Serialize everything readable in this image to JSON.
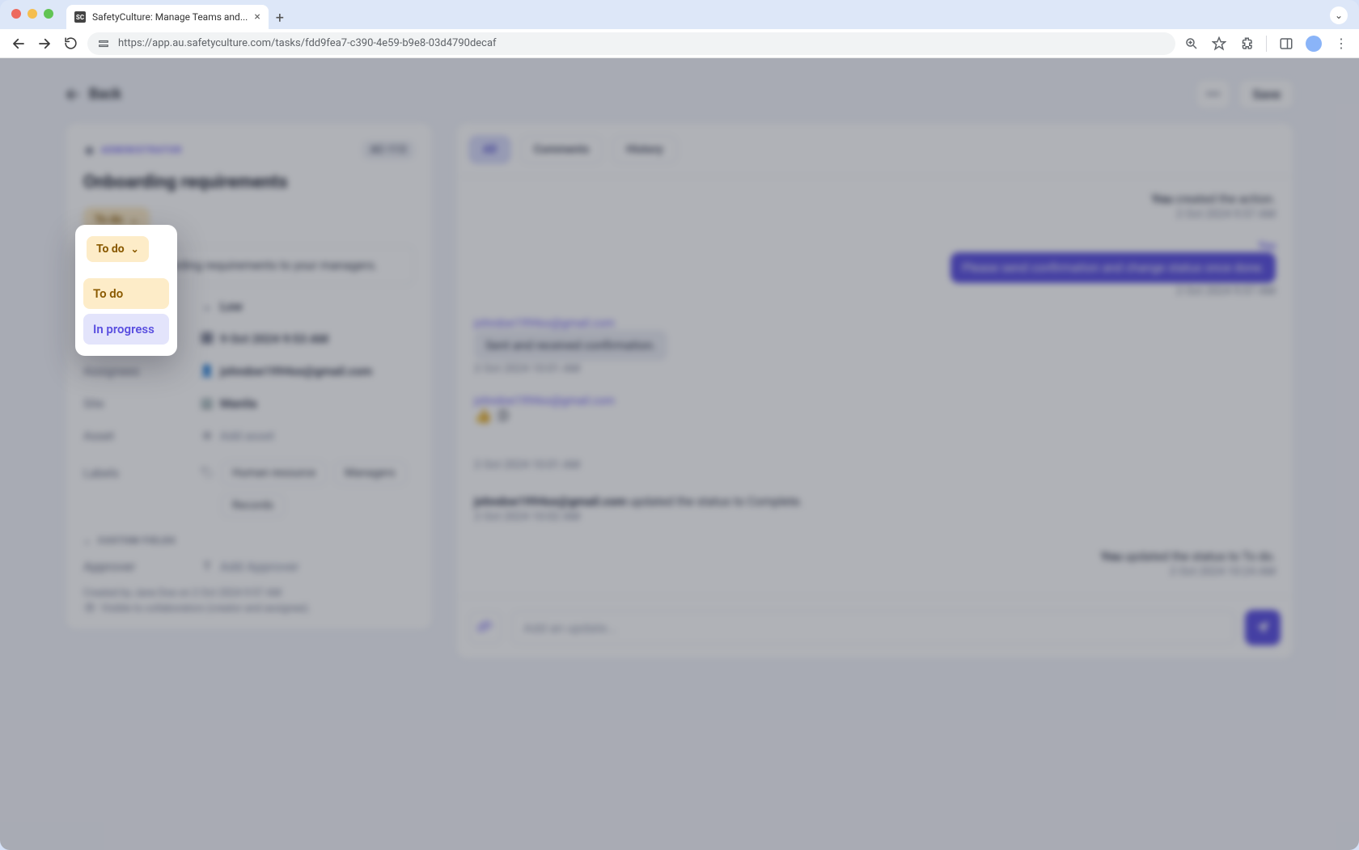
{
  "browser": {
    "tab_title": "SafetyCulture: Manage Teams and...",
    "favicon_text": "SC",
    "url": "https://app.au.safetyculture.com/tasks/fdd9fea7-c390-4e59-b9e8-03d4790decaf"
  },
  "header": {
    "back_label": "Back",
    "save_label": "Save",
    "more_label": "•••"
  },
  "task": {
    "badge": "ADMINISTRATOR",
    "code": "AC-113",
    "title": "Onboarding requirements",
    "status_current": "To do",
    "description": "Send all onboarding requirements to your managers.",
    "fields": {
      "priority": {
        "label": "Priority",
        "value": "Low"
      },
      "due": {
        "label": "Due date",
        "value": "9 Oct 2024 9:53 AM"
      },
      "assignee": {
        "label": "Assignees",
        "value": "johndoe1994xx@gmail.com"
      },
      "site": {
        "label": "Site",
        "value": "Manila"
      },
      "asset": {
        "label": "Asset",
        "placeholder": "Add asset"
      },
      "labels": {
        "label": "Labels",
        "items": [
          "Human resource",
          "Managers",
          "Records"
        ]
      }
    },
    "custom_fields_header": "CUSTOM FIELDS",
    "approver": {
      "label": "Approver",
      "placeholder": "Add Approver"
    },
    "created_by": "Created by Jane Doe on 2 Oct 2024 9:57 AM",
    "visibility": "Visible to collaborators (creator and assignee)."
  },
  "status_menu": {
    "current": "To do",
    "options": {
      "todo": "To do",
      "in_progress": "In progress"
    }
  },
  "activity": {
    "tabs": {
      "all": "All",
      "comments": "Comments",
      "history": "History"
    },
    "e1": {
      "text_prefix": "You",
      "text_rest": " created the action.",
      "ts": "2 Oct 2024 9:57 AM"
    },
    "e2": {
      "author": "You",
      "bubble": "Please send confirmation and change status once done.",
      "ts": "2 Oct 2024 9:57 AM"
    },
    "e3": {
      "author": "johndoe1994xx@gmail.com",
      "bubble": "Sent and received confirmation.",
      "ts": "2 Oct 2024 10:01 AM"
    },
    "e4": {
      "author": "johndoe1994xx@gmail.com",
      "reaction": "👍 :D",
      "ts": "2 Oct 2024 10:01 AM"
    },
    "e5": {
      "text": "johndoe1994xx@gmail.com updated the status to Complete.",
      "author": "johndoe1994xx@gmail.com",
      "rest": " updated the status to Complete.",
      "ts": "2 Oct 2024 10:02 AM"
    },
    "e6": {
      "text_prefix": "You",
      "text_rest": " updated the status to To do.",
      "ts": "2 Oct 2024 10:24 AM"
    },
    "composer_placeholder": "Add an update..."
  }
}
